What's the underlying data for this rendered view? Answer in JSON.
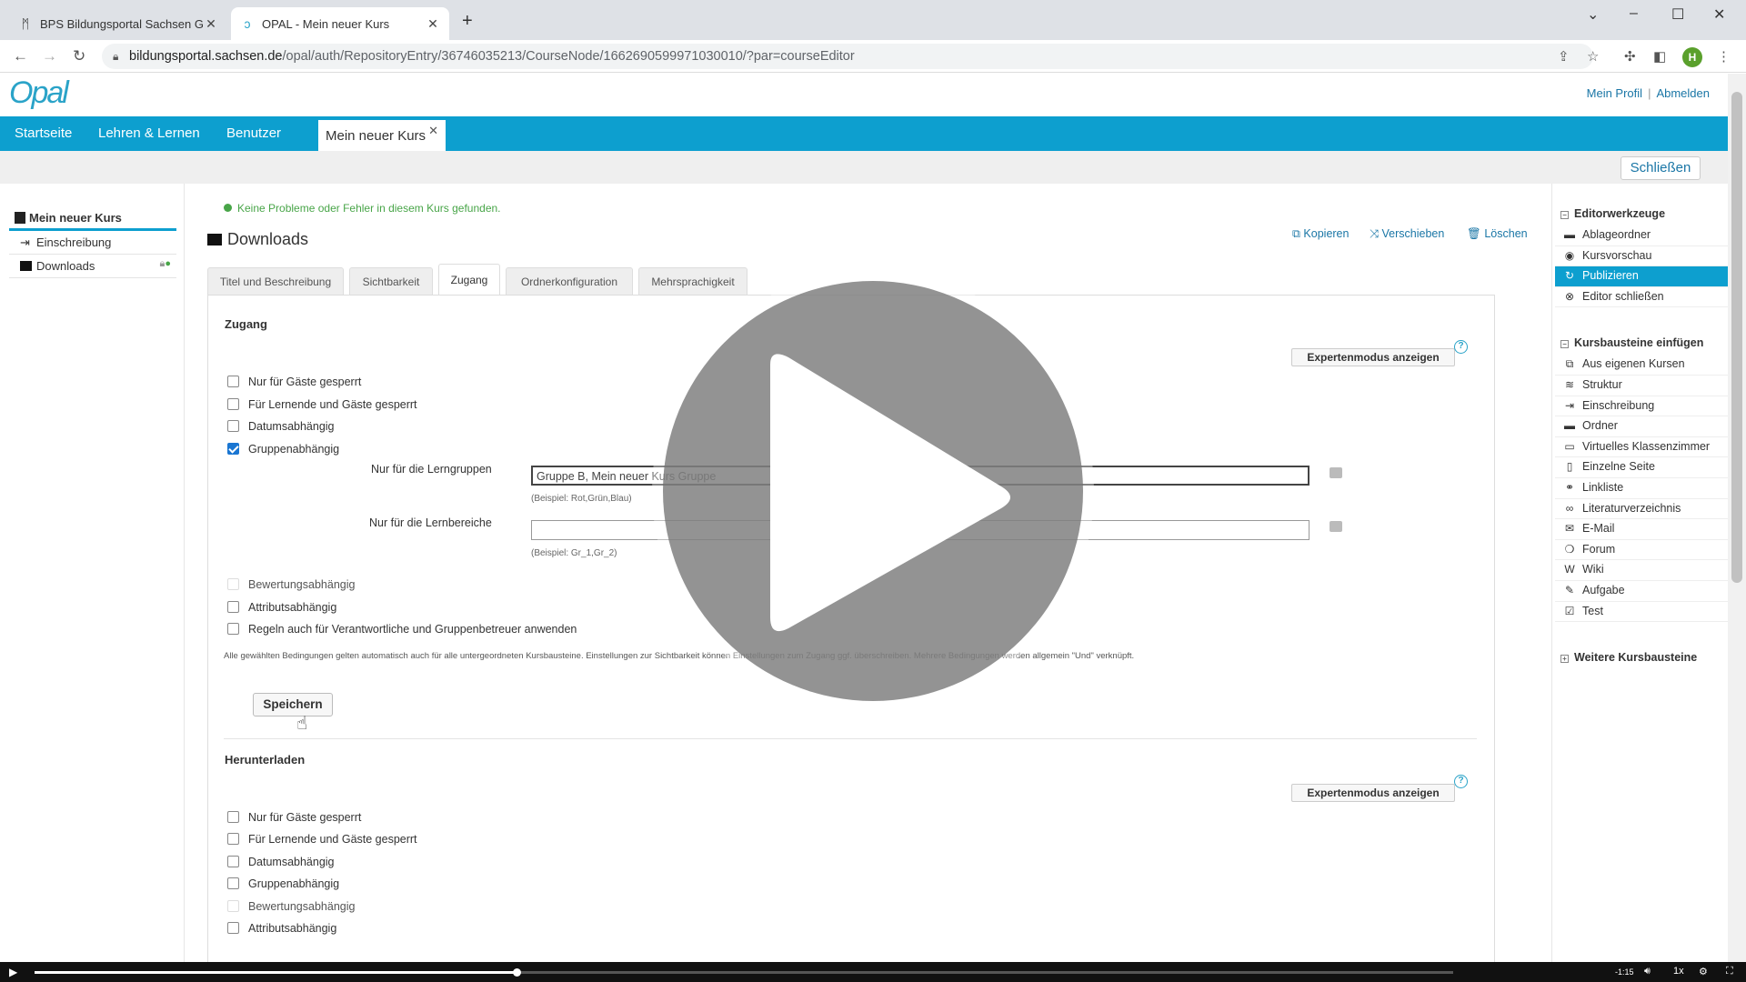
{
  "browser": {
    "tabs": [
      {
        "title": "BPS Bildungsportal Sachsen Gmb",
        "active": false
      },
      {
        "title": "OPAL - Mein neuer Kurs",
        "active": true
      }
    ],
    "url_host": "bildungsportal.sachsen.de",
    "url_path": "/opal/auth/RepositoryEntry/36746035213/CourseNode/1662690599971030010/?par=courseEditor",
    "profile_initial": "H"
  },
  "header": {
    "logo": "Opal",
    "profile_link": "Mein Profil",
    "logout_link": "Abmelden",
    "nav": [
      "Startseite",
      "Lehren & Lernen",
      "Benutzer"
    ],
    "course_tab": "Mein neuer Kurs",
    "close_button": "Schließen"
  },
  "tree": {
    "root": "Mein neuer Kurs",
    "items": [
      "Einschreibung",
      "Downloads"
    ]
  },
  "content": {
    "status": "Keine Probleme oder Fehler in diesem Kurs gefunden.",
    "title": "Downloads",
    "actions": [
      "Kopieren",
      "Verschieben",
      "Löschen"
    ],
    "tabs": [
      "Titel und Beschreibung",
      "Sichtbarkeit",
      "Zugang",
      "Ordnerkonfiguration",
      "Mehrsprachigkeit"
    ],
    "active_tab": "Zugang",
    "access": {
      "title": "Zugang",
      "expert_button": "Expertenmodus anzeigen",
      "help": "?",
      "checkboxes_top": [
        {
          "label": "Nur für Gäste gesperrt",
          "checked": false
        },
        {
          "label": "Für Lernende und Gäste gesperrt",
          "checked": false
        },
        {
          "label": "Datumsabhängig",
          "checked": false
        },
        {
          "label": "Gruppenabhängig",
          "checked": true
        }
      ],
      "group_label": "Nur für die Lerngruppen",
      "group_value": "Gruppe B, Mein neuer Kurs Gruppe",
      "group_hint": "(Beispiel: Rot,Grün,Blau)",
      "area_label": "Nur für die Lernbereiche",
      "area_value": "",
      "area_hint": "(Beispiel: Gr_1,Gr_2)",
      "checkboxes_bottom": [
        {
          "label": "Bewertungsabhängig",
          "checked": false,
          "disabled": true
        },
        {
          "label": "Attributsabhängig",
          "checked": false
        },
        {
          "label": "Regeln auch für Verantwortliche und Gruppenbetreuer anwenden",
          "checked": false
        }
      ],
      "note": "Alle gewählten Bedingungen gelten automatisch auch für alle untergeordneten Kursbausteine. Einstellungen zur Sichtbarkeit können Einstellungen zum Zugang ggf. überschreiben. Mehrere Bedingungen werden allgemein \"Und\" verknüpft.",
      "save_button": "Speichern"
    },
    "download": {
      "title": "Herunterladen",
      "expert_button": "Expertenmodus anzeigen",
      "help": "?",
      "checkboxes": [
        {
          "label": "Nur für Gäste gesperrt"
        },
        {
          "label": "Für Lernende und Gäste gesperrt"
        },
        {
          "label": "Datumsabhängig"
        },
        {
          "label": "Gruppenabhängig"
        },
        {
          "label": "Bewertungsabhängig",
          "disabled": true
        },
        {
          "label": "Attributsabhängig"
        }
      ]
    }
  },
  "right": {
    "editor_tools_title": "Editorwerkzeuge",
    "editor_tools": [
      {
        "label": "Ablageordner",
        "icon": "folder-icon"
      },
      {
        "label": "Kursvorschau",
        "icon": "eye-icon"
      },
      {
        "label": "Publizieren",
        "icon": "publish-icon",
        "selected": true
      },
      {
        "label": "Editor schließen",
        "icon": "close-circle-icon"
      }
    ],
    "insert_title": "Kursbausteine einfügen",
    "insert_items": [
      {
        "label": "Aus eigenen Kursen",
        "icon": "copy-icon"
      },
      {
        "label": "Struktur",
        "icon": "layers-icon"
      },
      {
        "label": "Einschreibung",
        "icon": "enroll-icon"
      },
      {
        "label": "Ordner",
        "icon": "folder-icon"
      },
      {
        "label": "Virtuelles Klassenzimmer",
        "icon": "monitor-icon"
      },
      {
        "label": "Einzelne Seite",
        "icon": "page-icon"
      },
      {
        "label": "Linkliste",
        "icon": "link-icon"
      },
      {
        "label": "Literaturverzeichnis",
        "icon": "binoculars-icon"
      },
      {
        "label": "E-Mail",
        "icon": "mail-icon"
      },
      {
        "label": "Forum",
        "icon": "forum-icon"
      },
      {
        "label": "Wiki",
        "icon": "wiki-icon"
      },
      {
        "label": "Aufgabe",
        "icon": "edit-icon"
      },
      {
        "label": "Test",
        "icon": "checkbox-icon"
      }
    ],
    "more_title": "Weitere Kursbausteine"
  },
  "video": {
    "progress": 0.34,
    "time_remaining": "-1:15",
    "speed": "1x"
  },
  "colors": {
    "accent": "#0d9fcf",
    "link": "#1a76a6",
    "ok": "#48a548",
    "checked": "#1a76d2"
  }
}
